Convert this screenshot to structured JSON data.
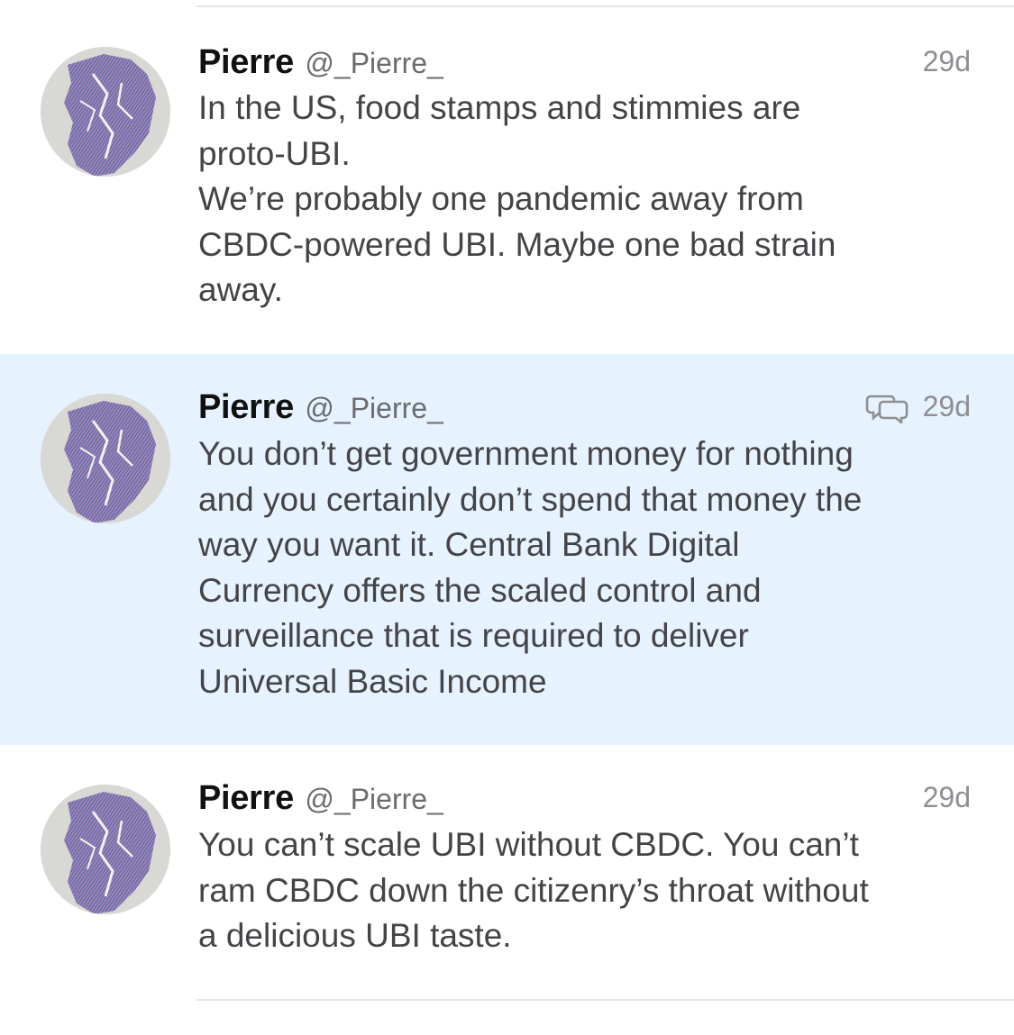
{
  "tweets": [
    {
      "name": "Pierre",
      "handle": "@_Pierre_",
      "time": "29d",
      "lines": [
        "In the US, food stamps and stimmies are",
        "proto-UBI.",
        "We’re probably one pandemic away from",
        "CBDC-powered UBI. Maybe one bad strain",
        "away."
      ]
    },
    {
      "name": "Pierre",
      "handle": "@_Pierre_",
      "time": "29d",
      "highlighted": true,
      "icon": "conversation-icon",
      "lines": [
        "You don’t get government money for nothing",
        "and you certainly don’t spend that money the",
        "way you want it. Central Bank Digital",
        "Currency offers the scaled control and",
        "surveillance that is required to deliver",
        "Universal Basic Income"
      ]
    },
    {
      "name": "Pierre",
      "handle": "@_Pierre_",
      "time": "29d",
      "lines": [
        "You can’t scale UBI without CBDC. You can’t",
        "ram CBDC down the citizenry’s throat without",
        "a delicious UBI taste."
      ]
    }
  ],
  "colors": {
    "highlight_bg": "#e6f2fd",
    "separator": "#e4e4e7",
    "name": "#111111",
    "handle": "#6b6b70",
    "time": "#8e8e93",
    "body": "#444448"
  }
}
